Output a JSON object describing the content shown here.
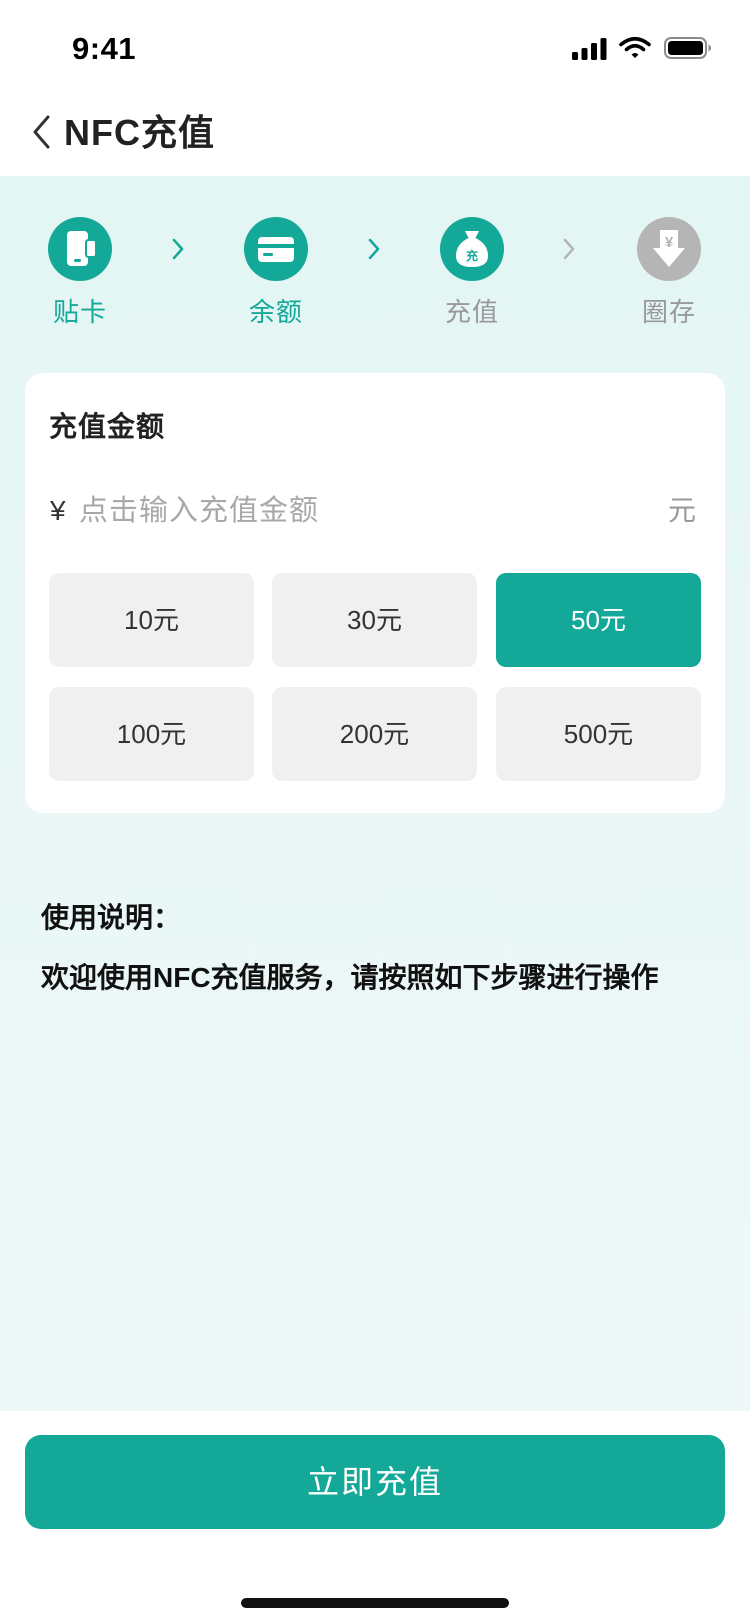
{
  "status_bar": {
    "time": "9:41",
    "icons": [
      "signal-icon",
      "wifi-icon",
      "battery-icon"
    ]
  },
  "nav": {
    "back_icon": "chevron-left-icon",
    "title": "NFC充值"
  },
  "steps": {
    "items": [
      {
        "label": "贴卡",
        "icon": "phone-card-icon",
        "circle_color": "#14a899",
        "label_color": "#14a899"
      },
      {
        "label": "余额",
        "icon": "bank-card-icon",
        "circle_color": "#14a899",
        "label_color": "#14a899"
      },
      {
        "label": "充值",
        "icon": "money-bag-icon",
        "icon_text": "充",
        "circle_color": "#14a899",
        "label_color": "#999999"
      },
      {
        "label": "圈存",
        "icon": "yuan-download-icon",
        "icon_text": "¥",
        "circle_color": "#b5b5b5",
        "label_color": "#999999"
      }
    ],
    "arrows": [
      {
        "icon": "chevron-right-icon",
        "color": "#14a899"
      },
      {
        "icon": "chevron-right-icon",
        "color": "#14a899"
      },
      {
        "icon": "chevron-right-icon",
        "color": "#b5b5b5"
      }
    ]
  },
  "amount": {
    "title": "充值金额",
    "currency_symbol": "¥",
    "placeholder": "点击输入充值金额",
    "unit": "元",
    "options": [
      {
        "label": "10元",
        "selected": false
      },
      {
        "label": "30元",
        "selected": false
      },
      {
        "label": "50元",
        "selected": true
      },
      {
        "label": "100元",
        "selected": false
      },
      {
        "label": "200元",
        "selected": false
      },
      {
        "label": "500元",
        "selected": false
      }
    ]
  },
  "instructions": {
    "title": "使用说明：",
    "text": "欢迎使用NFC充值服务，请按照如下步骤进行操作"
  },
  "submit": {
    "label": "立即充值"
  },
  "colors": {
    "accent": "#14a899",
    "inactive": "#b5b5b5",
    "option_bg": "#f0f0f0",
    "background_top": "#e3f6f3",
    "background_bottom": "#eef8f9"
  }
}
